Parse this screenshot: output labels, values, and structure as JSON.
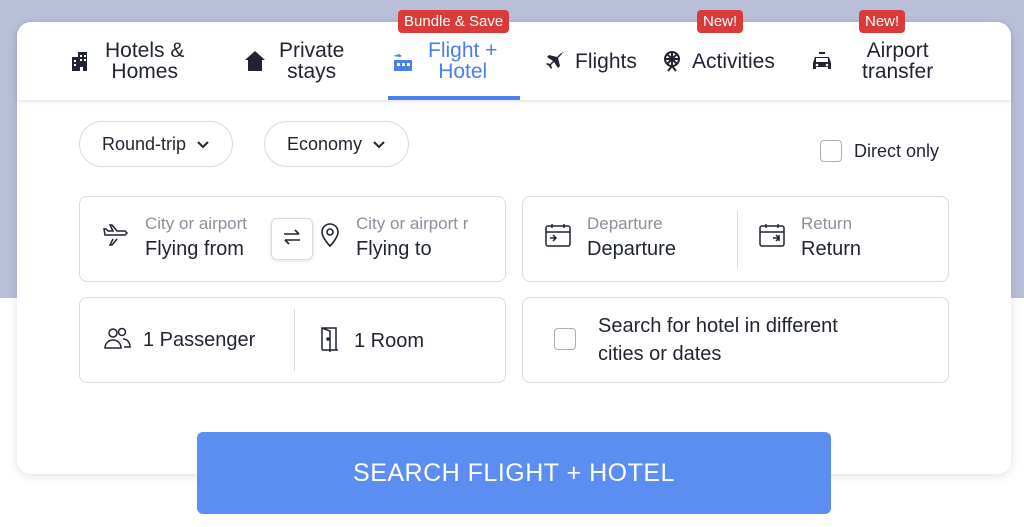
{
  "tabs": [
    {
      "label_line1": "Hotels &",
      "label_line2": "Homes",
      "icon": "hotel-building-icon"
    },
    {
      "label_line1": "Private",
      "label_line2": "stays",
      "icon": "house-icon"
    },
    {
      "label_line1": "Flight +",
      "label_line2": "Hotel",
      "icon": "flight-hotel-icon",
      "badge": "Bundle & Save",
      "active": true
    },
    {
      "label_line1": "Flights",
      "icon": "airplane-icon"
    },
    {
      "label_line1": "Activities",
      "icon": "ferris-wheel-icon",
      "badge": "New!"
    },
    {
      "label_line1": "Airport",
      "label_line2": "transfer",
      "icon": "car-icon",
      "badge": "New!"
    }
  ],
  "trip_type": "Round-trip",
  "cabin_class": "Economy",
  "direct_only": {
    "label": "Direct only",
    "checked": false
  },
  "from": {
    "placeholder": "City or airport",
    "value": "Flying from",
    "icon": "airplane-icon"
  },
  "to": {
    "placeholder": "City or airport r",
    "value": "Flying to",
    "icon": "location-pin-icon"
  },
  "departure": {
    "placeholder": "Departure",
    "value": "Departure",
    "icon": "calendar-icon"
  },
  "return": {
    "placeholder": "Return",
    "value": "Return",
    "icon": "calendar-return-icon"
  },
  "passengers": {
    "value": "1 Passenger",
    "icon": "people-icon"
  },
  "rooms": {
    "value": "1 Room",
    "icon": "door-icon"
  },
  "different_cities": {
    "line1": "Search for hotel in different",
    "line2": "cities or dates",
    "checked": false
  },
  "search_button": "SEARCH FLIGHT + HOTEL",
  "colors": {
    "accent": "#4a7ff0",
    "badge": "#d93a3a",
    "button": "#5b8ef0",
    "background_band": "#b9bfd9"
  }
}
